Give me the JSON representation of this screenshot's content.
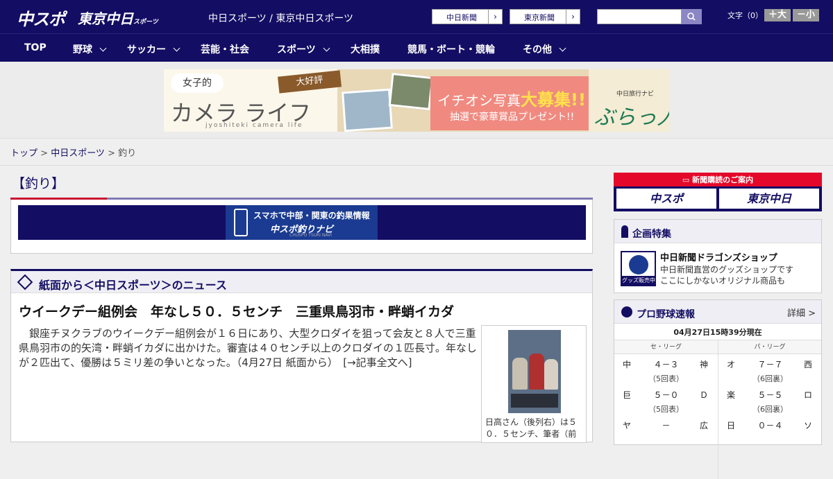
{
  "header": {
    "logo_main": "中スポ",
    "logo_sub": "東京中日",
    "logo_sub_small": "スポーツ",
    "site_links": "中日スポーツ / 東京中日スポーツ",
    "papers": [
      "中日新聞",
      "東京新聞"
    ],
    "font_size_label": "文字（0）",
    "font_larger": "＋大",
    "font_smaller": "－小"
  },
  "nav": [
    {
      "label": "TOP",
      "dropdown": false
    },
    {
      "label": "野球",
      "dropdown": true
    },
    {
      "label": "サッカー",
      "dropdown": true
    },
    {
      "label": "芸能・社会",
      "dropdown": false
    },
    {
      "label": "スポーツ",
      "dropdown": true
    },
    {
      "label": "大相撲",
      "dropdown": false
    },
    {
      "label": "競馬・ボート・競輪",
      "dropdown": false
    },
    {
      "label": "その他",
      "dropdown": true
    }
  ],
  "banner": {
    "bubble": "女子的",
    "title": "カメラ ライフ",
    "romaji": "jyoshiteki camera life",
    "ribbon": "大好評",
    "headline_a": "イチオシ写真",
    "headline_b": "大募集!!",
    "prize": "抽選で豪華賞品プレゼント!!",
    "brand_small": "中日旅行ナビ",
    "brand": "ぶらっ人"
  },
  "breadcrumb": {
    "home": "トップ",
    "sep1": " > ",
    "section": "中日スポーツ",
    "sep2": " > ",
    "current": "釣り"
  },
  "main": {
    "title": "【釣り】",
    "navi_banner": {
      "line1": "スマホで中部・関東の釣果情報",
      "line2": "中スポ釣りナビ",
      "line3": "CHUSPO TSURI NAVI"
    },
    "news_section_label": "紙面から＜中日スポーツ＞のニュース",
    "article": {
      "title": "ウイークデー組例会　年なし５０．５センチ　三重県鳥羽市・畔蛸イカダ",
      "body": "　銀座チヌクラブのウイークデー組例会が１６日にあり、大型クロダイを狙って会友と８人で三重県鳥羽市の的矢湾・畔蛸イカダに出かけた。審査は４０センチ以上のクロダイの１匹長寸。年なしが２匹出て、優勝は５ミリ差の争いとなった。（4月27日 紙面から）　[→記事全文へ]",
      "photo_caption": "日高さん（後列右）は５０．５センチ、筆者（前"
    }
  },
  "sidebar": {
    "subscription": {
      "label": "新聞購読のご案内",
      "buttons": [
        "中スポ",
        "東京中日"
      ]
    },
    "features": {
      "title": "企画特集",
      "logo_label": "グッズ販売中",
      "shop_title": "中日新聞ドラゴンズショップ",
      "shop_desc_1": "中日新聞直営のグッズショップです",
      "shop_desc_2": "ここにしかないオリジナル商品も"
    },
    "scores": {
      "title": "プロ野球速報",
      "detail": "詳細 >",
      "timestamp": "04月27日15時39分現在",
      "central": "セ・リーグ",
      "pacific": "パ・リーグ",
      "central_games": [
        {
          "home": "中",
          "score": "４－３",
          "away": "神",
          "inning": "（5回表）"
        },
        {
          "home": "巨",
          "score": "５－０",
          "away": "Ｄ",
          "inning": "（5回表）"
        },
        {
          "home": "ヤ",
          "score": "－",
          "away": "広",
          "inning": ""
        }
      ],
      "pacific_games": [
        {
          "home": "オ",
          "score": "７－７",
          "away": "西",
          "inning": "（6回裏）"
        },
        {
          "home": "楽",
          "score": "５－５",
          "away": "ロ",
          "inning": "（6回裏）"
        },
        {
          "home": "日",
          "score": "０－４",
          "away": "ソ",
          "inning": ""
        }
      ]
    }
  }
}
